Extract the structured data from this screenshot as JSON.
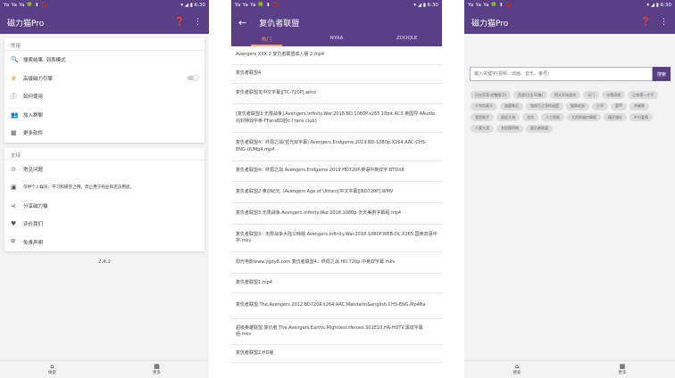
{
  "status": {
    "left": "Ya Ya Ya 🍀 ⬇ 🐞",
    "right": "▾ ◢ ▮ 6:30"
  },
  "panel1": {
    "title": "磁力猫Pro",
    "help_icon": "help-icon",
    "more_icon": "more-vert-icon",
    "sections": [
      {
        "header": "常用",
        "items": [
          {
            "icon": "search-icon",
            "label": "搜索结果: 列表模式",
            "toggle": false
          },
          {
            "icon": "crown-icon",
            "label": "高级磁力引擎",
            "toggle": true
          },
          {
            "icon": "info-icon",
            "label": "如何使用",
            "toggle": false
          },
          {
            "icon": "group-icon",
            "label": "加入群聊",
            "toggle": false
          },
          {
            "icon": "grid-icon",
            "label": "更多软件",
            "toggle": false
          }
        ]
      },
      {
        "header": "支持",
        "items": [
          {
            "icon": "help-circle-icon",
            "label": "常见问题",
            "toggle": false
          },
          {
            "icon": "alert-icon",
            "label": "仅供个人娱乐、学习和研究之用，禁止用于商业和违法用途。",
            "toggle": false
          },
          {
            "icon": "share-icon",
            "label": "分享磁力猫",
            "toggle": false
          },
          {
            "icon": "heart-icon",
            "label": "评价我们",
            "toggle": false
          },
          {
            "icon": "shield-icon",
            "label": "免责声明",
            "toggle": false
          }
        ]
      }
    ],
    "version": "2.4.2",
    "nav": [
      {
        "icon": "home-icon",
        "label": "搜索"
      },
      {
        "icon": "grid-icon",
        "label": "更多"
      }
    ]
  },
  "panel2": {
    "title": "复仇者联盟",
    "tabs": [
      "热门",
      "NYAA",
      "ZOOQLE"
    ],
    "results": [
      "Avengers XXX 2 复仇者联盟成人版 2.mp4",
      "复仇者联盟4",
      "复仇者联盟3[中文字幕][TC-720P].wmv",
      "[复仇者联盟3:无限战争].Avengers.Infinity.War.2018.BD.1080P.x265.10bit.AC3.英国导.4Audio.内封特效中英-FFansBD脸c.f fans.club]",
      "复仇者联盟4：终局之战(蓝光双字幕).Avengers.Endgame.2019.BD-1080p.X264.AAC-CHS-ENG-UUMp4.mp4",
      "复仇者联盟4：终局之战.Avengers.Endgame.2019.HD720P.英语中英双字.BTDX8",
      "复仇者联盟2 奥创纪元（Avengers Age of Ultron)[中文字幕][BD720P].WMV",
      "复仇者联盟3.无限战争.Avengers.Infinity.War.2018.1080p-天天美剧字幕组.mp4",
      "复仇者联盟3：无限战争大陆公映版 Avengers.Infinity.War.2018.1080P.WEB-DL.X265.国英双语中字.mkv",
      "阳光电影www.ygdy8.com.复仇者联盟4：终局之战.HD.720p.中英双字幕.mkv",
      "复仇者联盟1.mp4",
      "复仇者联盟.The.Avengers.2012.BD720P.X264.AAC.Mandarin&english.CHS-ENG.Mp4Ba",
      "超级英雄联盟.复仇者.The.Avengers.Earths.Mightiest.Heroes.S01E10.HR-HDTV.黑纹字幕组.mkv",
      "复仇者联盟2.HD版"
    ]
  },
  "panel3": {
    "title": "磁力猫Pro",
    "search_placeholder": "输入关键字(视频、动画、音乐、番号)",
    "search_button": "搜索",
    "history": [
      "闪光芳菲·完整版(2)",
      "西游记(全32集)",
      "明天开始爱你",
      "天门",
      "冰雪奇缘",
      "江南第一才子",
      "少年包青天",
      "盗墓笔记",
      "鬼吹灯之龙岭迷窟",
      "猫和老鼠",
      "小学",
      "富甲",
      "杀破狼",
      "我是歌手",
      "星辰大海",
      "北京",
      "人工智能",
      "大侦探福尔摩斯",
      "精灵旅社",
      "乡村爱情",
      "人类大战",
      "名侦探柯南",
      "复仇者联盟"
    ],
    "nav": [
      {
        "icon": "home-icon",
        "label": "搜索"
      },
      {
        "icon": "grid-icon",
        "label": "更多"
      }
    ]
  },
  "colors": {
    "primary": "#5a3f86",
    "accent": "#ff9f5a"
  }
}
